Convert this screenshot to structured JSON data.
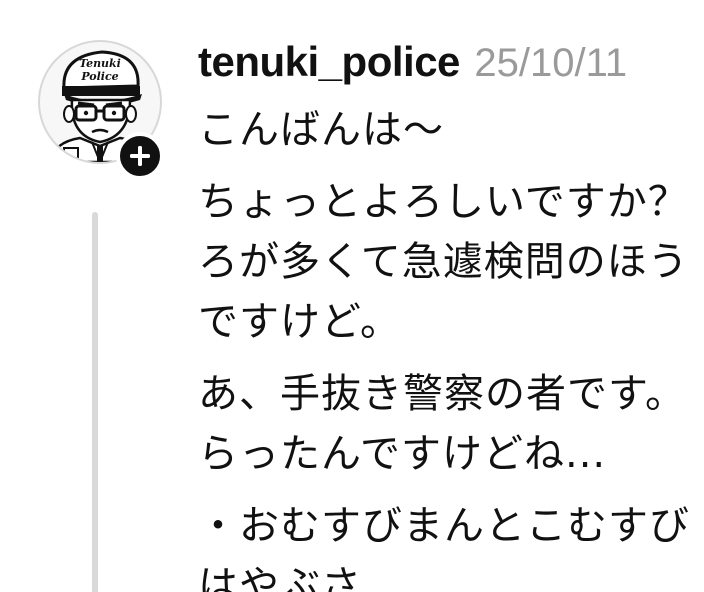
{
  "post": {
    "username": "tenuki_police",
    "timestamp": "25/10/11",
    "lines": [
      "こんばんは〜",
      "ちょっとよろしいですか？",
      "ろが多くて急遽検問のほう",
      "ですけど。",
      "あ、手抜き警察の者です。",
      "らったんですけどね...",
      "・おむすびまんとこむすび",
      "はやぶさ"
    ]
  },
  "avatar": {
    "icon": "police-officer-avatar-icon",
    "cap_text": [
      "Tenuki",
      "Police"
    ]
  },
  "colors": {
    "text": "#111111",
    "timestamp": "#9a9a9a",
    "thread_line": "#d9d9d9",
    "follow_button": "#111111"
  }
}
